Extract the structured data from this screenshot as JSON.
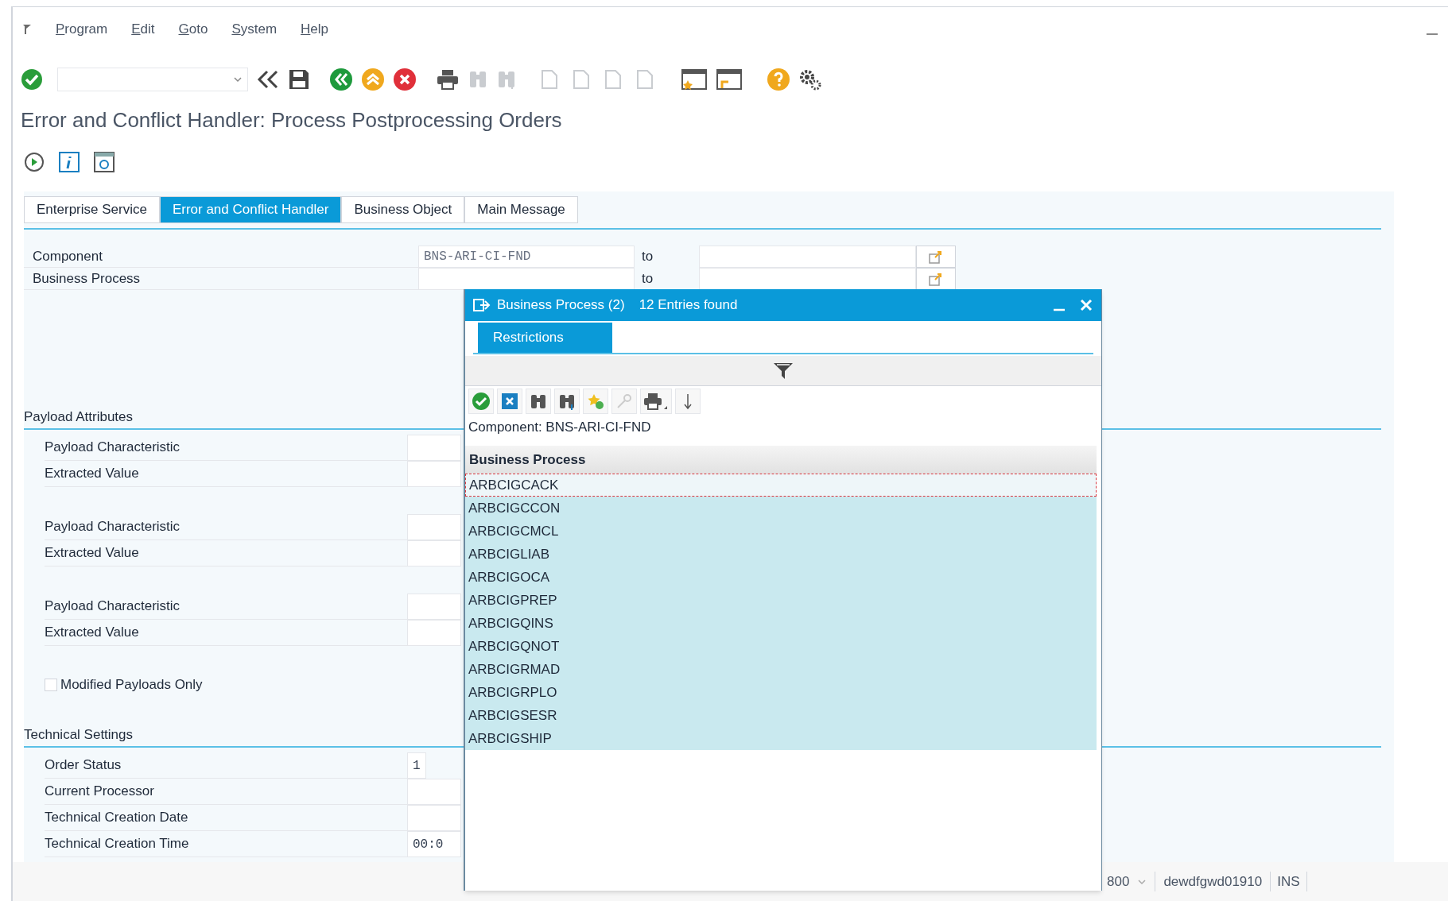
{
  "menu": [
    {
      "label": "Program"
    },
    {
      "label": "Edit"
    },
    {
      "label": "Goto"
    },
    {
      "label": "System"
    },
    {
      "label": "Help"
    }
  ],
  "title": "Error and Conflict Handler: Process Postprocessing Orders",
  "tabs": [
    {
      "label": "Enterprise Service",
      "selected": false
    },
    {
      "label": "Error and Conflict Handler",
      "selected": true
    },
    {
      "label": "Business Object",
      "selected": false
    },
    {
      "label": "Main Message",
      "selected": false
    }
  ],
  "selection": [
    {
      "label": "Component",
      "from": "BNS-ARI-CI-FND",
      "to_label": "to"
    },
    {
      "label": "Business Process",
      "to_label": "to"
    }
  ],
  "payload_attributes": {
    "heading": "Payload Attributes",
    "groups": [
      [
        {
          "label": "Payload Characteristic"
        },
        {
          "label": "Extracted Value"
        }
      ],
      [
        {
          "label": "Payload Characteristic"
        },
        {
          "label": "Extracted Value"
        }
      ],
      [
        {
          "label": "Payload Characteristic"
        },
        {
          "label": "Extracted Value"
        }
      ]
    ],
    "checkbox": {
      "label": "Modified Payloads Only",
      "checked": false
    }
  },
  "technical_settings": {
    "heading": "Technical Settings",
    "rows": [
      {
        "label": "Order Status",
        "value": "1"
      },
      {
        "label": "Current Processor"
      },
      {
        "label": "Technical Creation Date"
      },
      {
        "label": "Technical Creation Time",
        "value": "00:0"
      }
    ]
  },
  "popup": {
    "title": "Business Process (2)",
    "entries_found": "12 Entries found",
    "tab": {
      "label": "Restrictions",
      "selected": true
    },
    "info": "Component: BNS-ARI-CI-FND",
    "column": "Business Process",
    "rows": [
      {
        "value": "ARBCIGCACK",
        "selected": true
      },
      {
        "value": "ARBCIGCCON",
        "selected": false
      },
      {
        "value": "ARBCIGCMCL",
        "selected": false
      },
      {
        "value": "ARBCIGLIAB",
        "selected": false
      },
      {
        "value": "ARBCIGOCA",
        "selected": false
      },
      {
        "value": "ARBCIGPREP",
        "selected": false
      },
      {
        "value": "ARBCIGQINS",
        "selected": false
      },
      {
        "value": "ARBCIGQNOT",
        "selected": false
      },
      {
        "value": "ARBCIGRMAD",
        "selected": false
      },
      {
        "value": "ARBCIGRPLO",
        "selected": false
      },
      {
        "value": "ARBCIGSESR",
        "selected": false
      },
      {
        "value": "ARBCIGSHIP",
        "selected": false
      }
    ]
  },
  "status_bar": {
    "client": "800",
    "host": "dewdfgwd01910",
    "mode": "INS"
  }
}
